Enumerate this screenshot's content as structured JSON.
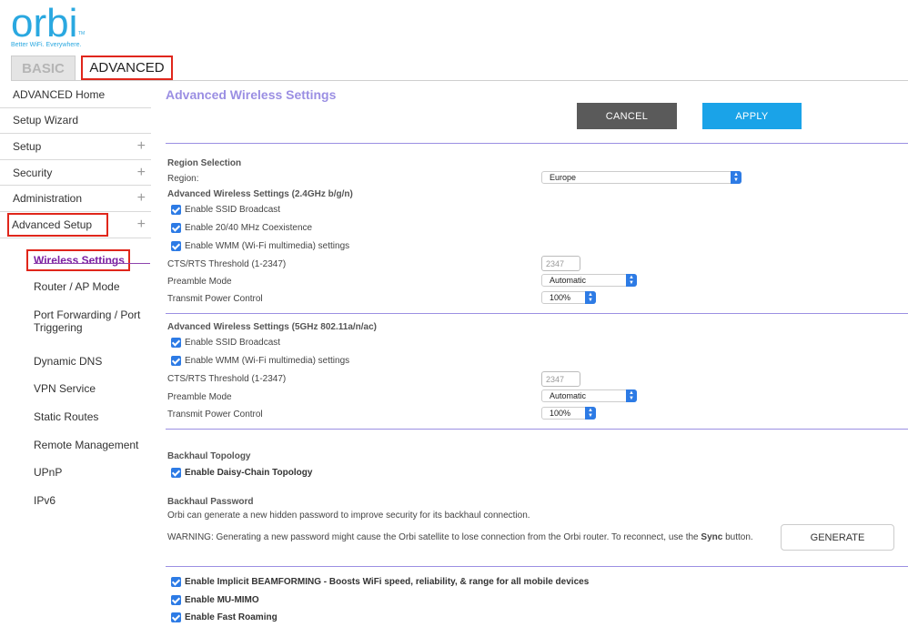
{
  "header": {
    "logo": "orbi",
    "logo_tm": "TM",
    "tagline": "Better WiFi. Everywhere."
  },
  "tabs": [
    {
      "label": "BASIC"
    },
    {
      "label": "ADVANCED"
    }
  ],
  "sidebar": {
    "items": [
      {
        "label": "ADVANCED Home"
      },
      {
        "label": "Setup Wizard"
      },
      {
        "label": "Setup"
      },
      {
        "label": "Security"
      },
      {
        "label": "Administration"
      },
      {
        "label": "Advanced Setup"
      }
    ],
    "sub_items": [
      {
        "label": "Wireless Settings"
      },
      {
        "label": "Router / AP Mode"
      },
      {
        "label": "Port Forwarding / Port Triggering"
      },
      {
        "label": "Dynamic DNS"
      },
      {
        "label": "VPN Service"
      },
      {
        "label": "Static Routes"
      },
      {
        "label": "Remote Management"
      },
      {
        "label": "UPnP"
      },
      {
        "label": "IPv6"
      }
    ]
  },
  "main": {
    "title": "Advanced Wireless Settings",
    "cancel_label": "CANCEL",
    "apply_label": "APPLY",
    "region": {
      "section": "Region Selection",
      "label": "Region:",
      "value": "Europe"
    },
    "band24": {
      "section": "Advanced Wireless Settings (2.4GHz b/g/n)",
      "ssid_broadcast": "Enable SSID Broadcast",
      "coexistence": "Enable 20/40 MHz Coexistence",
      "wmm": "Enable WMM (Wi-Fi multimedia) settings",
      "cts_label": "CTS/RTS Threshold (1-2347)",
      "cts_value": "2347",
      "preamble_label": "Preamble Mode",
      "preamble_value": "Automatic",
      "power_label": "Transmit Power Control",
      "power_value": "100%"
    },
    "band5": {
      "section": "Advanced Wireless Settings (5GHz 802.11a/n/ac)",
      "ssid_broadcast": "Enable SSID Broadcast",
      "wmm": "Enable WMM (Wi-Fi multimedia) settings",
      "cts_label": "CTS/RTS Threshold (1-2347)",
      "cts_value": "2347",
      "preamble_label": "Preamble Mode",
      "preamble_value": "Automatic",
      "power_label": "Transmit Power Control",
      "power_value": "100%"
    },
    "backhaul": {
      "topology_section": "Backhaul Topology",
      "daisy_chain": "Enable Daisy-Chain Topology",
      "password_section": "Backhaul Password",
      "password_desc": "Orbi can generate a new hidden password to improve security for its backhaul connection.",
      "warning_pre": "WARNING: Generating a new password might cause the Orbi satellite to lose connection from the Orbi router. To reconnect, use the ",
      "warning_bold": "Sync",
      "warning_post": " button.",
      "generate_label": "GENERATE"
    },
    "extras": {
      "beamforming": "Enable Implicit BEAMFORMING - Boosts WiFi speed, reliability, & range for all mobile devices",
      "mu_mimo": "Enable MU-MIMO",
      "fast_roaming": "Enable Fast Roaming"
    }
  },
  "colors": {
    "brand": "#2aa8e0",
    "title": "#9b8fe3",
    "apply": "#1aa3e8",
    "cancel": "#5a5a5a",
    "highlight": "#e0261b",
    "active_sub": "#7b1fa2"
  }
}
